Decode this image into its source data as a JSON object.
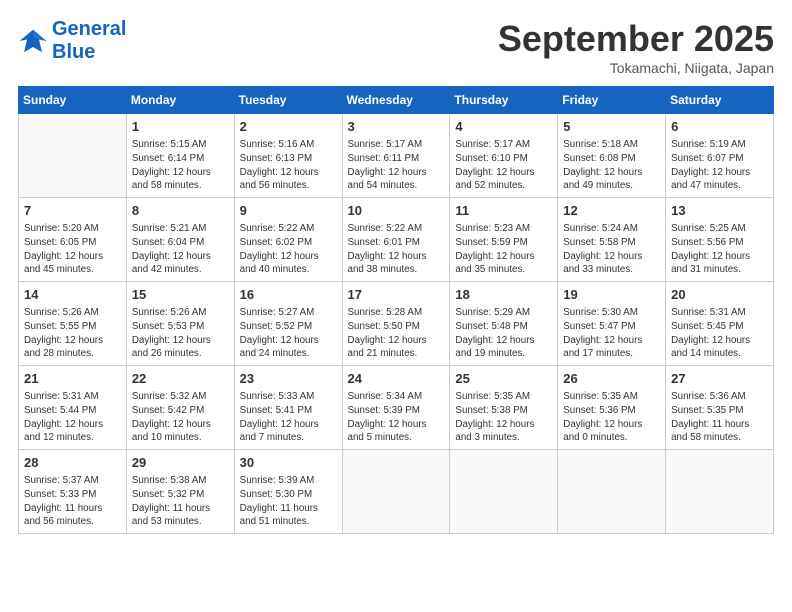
{
  "header": {
    "logo_line1": "General",
    "logo_line2": "Blue",
    "month": "September 2025",
    "location": "Tokamachi, Niigata, Japan"
  },
  "days_of_week": [
    "Sunday",
    "Monday",
    "Tuesday",
    "Wednesday",
    "Thursday",
    "Friday",
    "Saturday"
  ],
  "weeks": [
    [
      {
        "day": "",
        "info": ""
      },
      {
        "day": "1",
        "info": "Sunrise: 5:15 AM\nSunset: 6:14 PM\nDaylight: 12 hours\nand 58 minutes."
      },
      {
        "day": "2",
        "info": "Sunrise: 5:16 AM\nSunset: 6:13 PM\nDaylight: 12 hours\nand 56 minutes."
      },
      {
        "day": "3",
        "info": "Sunrise: 5:17 AM\nSunset: 6:11 PM\nDaylight: 12 hours\nand 54 minutes."
      },
      {
        "day": "4",
        "info": "Sunrise: 5:17 AM\nSunset: 6:10 PM\nDaylight: 12 hours\nand 52 minutes."
      },
      {
        "day": "5",
        "info": "Sunrise: 5:18 AM\nSunset: 6:08 PM\nDaylight: 12 hours\nand 49 minutes."
      },
      {
        "day": "6",
        "info": "Sunrise: 5:19 AM\nSunset: 6:07 PM\nDaylight: 12 hours\nand 47 minutes."
      }
    ],
    [
      {
        "day": "7",
        "info": "Sunrise: 5:20 AM\nSunset: 6:05 PM\nDaylight: 12 hours\nand 45 minutes."
      },
      {
        "day": "8",
        "info": "Sunrise: 5:21 AM\nSunset: 6:04 PM\nDaylight: 12 hours\nand 42 minutes."
      },
      {
        "day": "9",
        "info": "Sunrise: 5:22 AM\nSunset: 6:02 PM\nDaylight: 12 hours\nand 40 minutes."
      },
      {
        "day": "10",
        "info": "Sunrise: 5:22 AM\nSunset: 6:01 PM\nDaylight: 12 hours\nand 38 minutes."
      },
      {
        "day": "11",
        "info": "Sunrise: 5:23 AM\nSunset: 5:59 PM\nDaylight: 12 hours\nand 35 minutes."
      },
      {
        "day": "12",
        "info": "Sunrise: 5:24 AM\nSunset: 5:58 PM\nDaylight: 12 hours\nand 33 minutes."
      },
      {
        "day": "13",
        "info": "Sunrise: 5:25 AM\nSunset: 5:56 PM\nDaylight: 12 hours\nand 31 minutes."
      }
    ],
    [
      {
        "day": "14",
        "info": "Sunrise: 5:26 AM\nSunset: 5:55 PM\nDaylight: 12 hours\nand 28 minutes."
      },
      {
        "day": "15",
        "info": "Sunrise: 5:26 AM\nSunset: 5:53 PM\nDaylight: 12 hours\nand 26 minutes."
      },
      {
        "day": "16",
        "info": "Sunrise: 5:27 AM\nSunset: 5:52 PM\nDaylight: 12 hours\nand 24 minutes."
      },
      {
        "day": "17",
        "info": "Sunrise: 5:28 AM\nSunset: 5:50 PM\nDaylight: 12 hours\nand 21 minutes."
      },
      {
        "day": "18",
        "info": "Sunrise: 5:29 AM\nSunset: 5:48 PM\nDaylight: 12 hours\nand 19 minutes."
      },
      {
        "day": "19",
        "info": "Sunrise: 5:30 AM\nSunset: 5:47 PM\nDaylight: 12 hours\nand 17 minutes."
      },
      {
        "day": "20",
        "info": "Sunrise: 5:31 AM\nSunset: 5:45 PM\nDaylight: 12 hours\nand 14 minutes."
      }
    ],
    [
      {
        "day": "21",
        "info": "Sunrise: 5:31 AM\nSunset: 5:44 PM\nDaylight: 12 hours\nand 12 minutes."
      },
      {
        "day": "22",
        "info": "Sunrise: 5:32 AM\nSunset: 5:42 PM\nDaylight: 12 hours\nand 10 minutes."
      },
      {
        "day": "23",
        "info": "Sunrise: 5:33 AM\nSunset: 5:41 PM\nDaylight: 12 hours\nand 7 minutes."
      },
      {
        "day": "24",
        "info": "Sunrise: 5:34 AM\nSunset: 5:39 PM\nDaylight: 12 hours\nand 5 minutes."
      },
      {
        "day": "25",
        "info": "Sunrise: 5:35 AM\nSunset: 5:38 PM\nDaylight: 12 hours\nand 3 minutes."
      },
      {
        "day": "26",
        "info": "Sunrise: 5:35 AM\nSunset: 5:36 PM\nDaylight: 12 hours\nand 0 minutes."
      },
      {
        "day": "27",
        "info": "Sunrise: 5:36 AM\nSunset: 5:35 PM\nDaylight: 11 hours\nand 58 minutes."
      }
    ],
    [
      {
        "day": "28",
        "info": "Sunrise: 5:37 AM\nSunset: 5:33 PM\nDaylight: 11 hours\nand 56 minutes."
      },
      {
        "day": "29",
        "info": "Sunrise: 5:38 AM\nSunset: 5:32 PM\nDaylight: 11 hours\nand 53 minutes."
      },
      {
        "day": "30",
        "info": "Sunrise: 5:39 AM\nSunset: 5:30 PM\nDaylight: 11 hours\nand 51 minutes."
      },
      {
        "day": "",
        "info": ""
      },
      {
        "day": "",
        "info": ""
      },
      {
        "day": "",
        "info": ""
      },
      {
        "day": "",
        "info": ""
      }
    ]
  ]
}
